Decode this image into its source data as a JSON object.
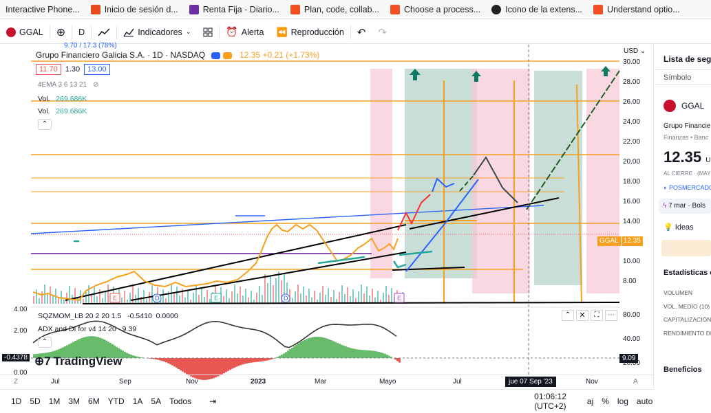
{
  "bookmarks": [
    {
      "label": "Interactive Phone...",
      "icon": "phone-icon",
      "color": ""
    },
    {
      "label": "Inicio de sesión d...",
      "icon": "cp-logo-icon",
      "color": "#e84a1a"
    },
    {
      "label": "Renta Fija - Diario...",
      "icon": "b-logo-icon",
      "color": "#6b2fa3"
    },
    {
      "label": "Plan, code, collab...",
      "icon": "windows-icon",
      "color": "#f25022"
    },
    {
      "label": "Choose a process...",
      "icon": "windows-icon",
      "color": "#f25022"
    },
    {
      "label": "Icono de la extens...",
      "icon": "github-icon",
      "color": "#222"
    },
    {
      "label": "Understand optio...",
      "icon": "windows-icon",
      "color": "#f25022"
    }
  ],
  "toolbar": {
    "symbol": "GGAL",
    "interval": "D",
    "indicators": "Indicadores",
    "alert": "Alerta",
    "replay": "Reproducción"
  },
  "legend": {
    "title": "Grupo Financiero Galicia S.A. · 1D · NASDAQ",
    "price": "12.35",
    "change": "+0.21 (+1.73%)",
    "top_partial": "9.70 / 17.3 (78%)",
    "bid": "11.70",
    "spread": "1.30",
    "ask": "13.00",
    "ema": "4EMA 3 6 13 21",
    "vol_label": "Vol.",
    "vol1": "269.686K",
    "vol2": "269.686K"
  },
  "price_axis": {
    "currency": "USD",
    "ticks": [
      "30.00",
      "28.00",
      "26.00",
      "24.00",
      "22.00",
      "20.00",
      "18.00",
      "16.00",
      "14.00",
      "12.00",
      "10.00",
      "8.00"
    ],
    "label_symbol": "GGAL",
    "label_price": "12.35"
  },
  "osc": {
    "sqz_label": "SQZMOM_LB 20 2 20 1.5",
    "sqz_val1": "-0.5410",
    "sqz_val2": "0.0000",
    "adx_label": "ADX and DI for v4 14 20",
    "adx_val": "9.39",
    "left_ticks": [
      "4.00",
      "2.00",
      "0.00"
    ],
    "left_marker": "-0.4378",
    "right_ticks": [
      "80.00",
      "40.00",
      "20.00"
    ],
    "right_marker": "9.09",
    "watermark": "TradingView"
  },
  "time_axis": {
    "labels": [
      "Jul",
      "Sep",
      "Nov",
      "2023",
      "Mar",
      "Mayo",
      "Jul",
      "Nov"
    ],
    "crosshair_date": "jue 07 Sep '23"
  },
  "bottom": {
    "ranges": [
      "1D",
      "5D",
      "1M",
      "3M",
      "6M",
      "YTD",
      "1A",
      "5A",
      "Todos"
    ],
    "clock": "01:06:12 (UTC+2)",
    "opt_adj": "aj",
    "opt_pct": "%",
    "opt_log": "log",
    "opt_auto": "auto"
  },
  "right_panel": {
    "watchlist": "Lista de segu",
    "symbol_header": "Símbolo",
    "ticker": "GGAL",
    "company": "Grupo Financier",
    "sector": "Finanzas • Banc",
    "price": "12.35",
    "currency_suffix": "U",
    "close_label": "AL CIERRE · (MAYO",
    "postmarket": "POSMERCADO",
    "event": "7 mar · Bols",
    "ideas": "Ideas",
    "stats_title": "Estadísticas cla",
    "stats": [
      "VOLUMEN",
      "VOL. MEDIO (10)",
      "CAPITALIZACIÓN",
      "RENDIMIENTO DE"
    ],
    "benefits": "Beneficios"
  },
  "colors": {
    "accent": "#2962ff",
    "up": "#26a69a",
    "down": "#ef5350",
    "orange": "#f7a01d",
    "pink_zone": "#f8c8d5",
    "green_zone": "#b7d3c9"
  }
}
